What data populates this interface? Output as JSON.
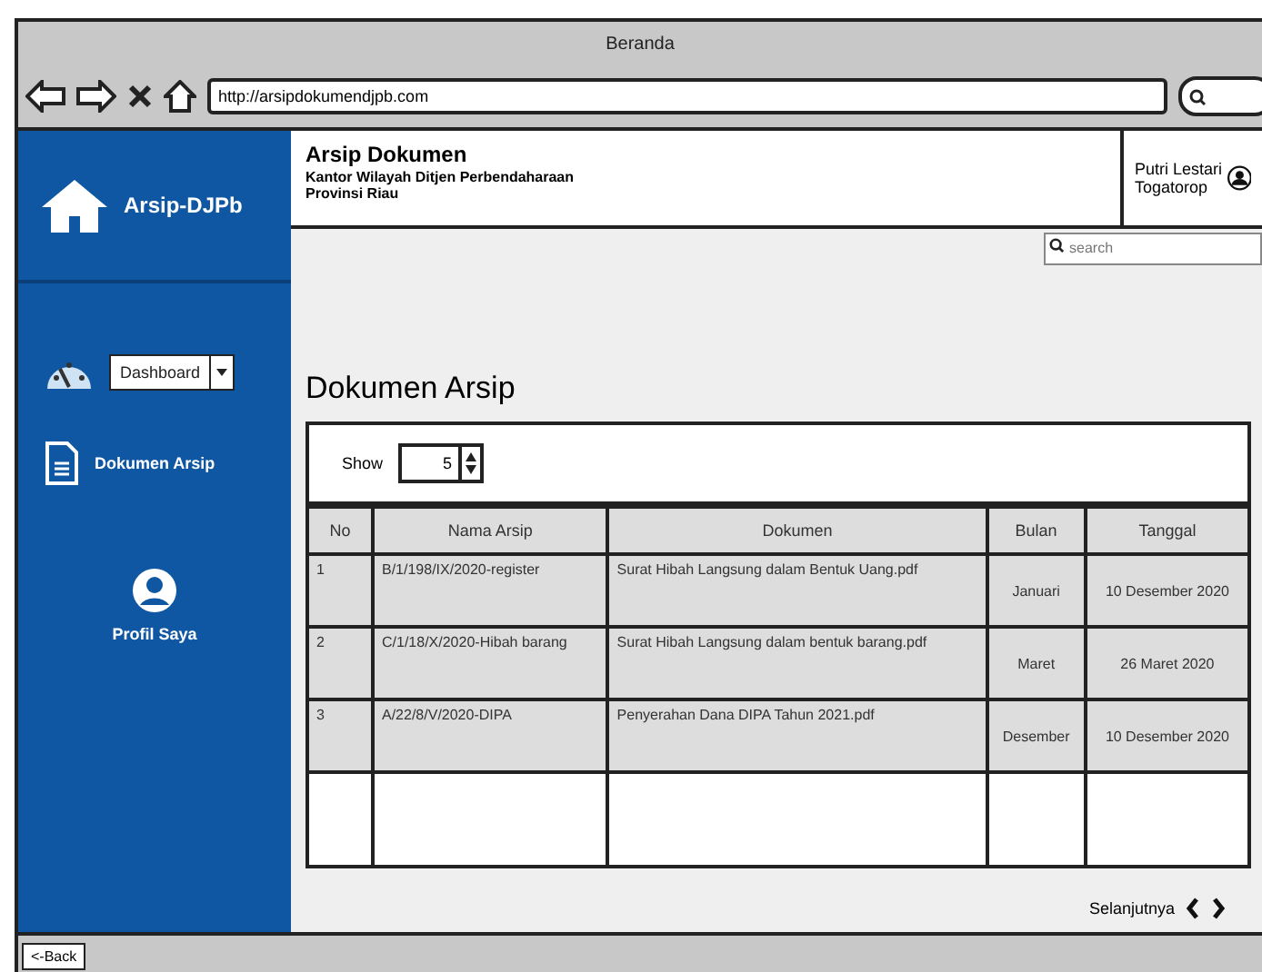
{
  "window": {
    "title": "Beranda"
  },
  "browser": {
    "url": "http://arsipdokumendjpb.com",
    "back_button": "<-Back"
  },
  "sidebar": {
    "brand": "Arsip-DJPb",
    "items": [
      {
        "kind": "dropdown",
        "label": "Dashboard"
      },
      {
        "kind": "link",
        "label": "Dokumen Arsip"
      },
      {
        "kind": "profile",
        "label": "Profil Saya"
      }
    ]
  },
  "header": {
    "title": "Arsip Dokumen",
    "subtitle": "Kantor Wilayah Ditjen Perbendaharaan Provinsi Riau",
    "user": "Putri Lestari Togatorop"
  },
  "search": {
    "placeholder": "search"
  },
  "page_title": "Dokumen Arsip",
  "show": {
    "label": "Show",
    "value": "5"
  },
  "table": {
    "columns": [
      "No",
      "Nama Arsip",
      "Dokumen",
      "Bulan",
      "Tanggal"
    ],
    "rows": [
      [
        "1",
        "B/1/198/IX/2020-register",
        "Surat Hibah Langsung dalam Bentuk Uang.pdf",
        "Januari",
        "10 Desember 2020"
      ],
      [
        "2",
        "C/1/18/X/2020-Hibah barang",
        "Surat Hibah Langsung dalam bentuk barang.pdf",
        "Maret",
        "26 Maret 2020"
      ],
      [
        "3",
        "A/22/8/V/2020-DIPA",
        "Penyerahan Dana DIPA Tahun 2021.pdf",
        "Desember",
        "10 Desember 2020"
      ]
    ]
  },
  "pagination": {
    "label": "Selanjutnya"
  }
}
